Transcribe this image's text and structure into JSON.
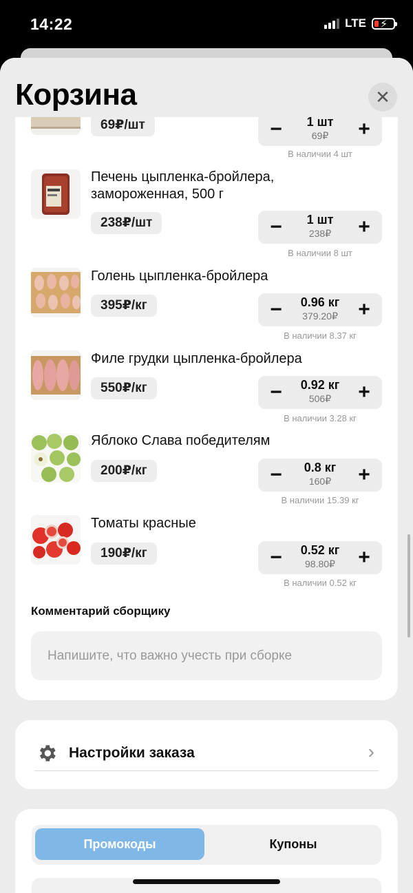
{
  "status": {
    "time": "14:22",
    "network": "LTE"
  },
  "header": {
    "title": "Корзина",
    "close_icon": "close-icon"
  },
  "cart": {
    "items": [
      {
        "name": "",
        "price": "69₽/шт",
        "qty": "1 шт",
        "sum": "69₽",
        "stock": "В наличии  4 шт",
        "thumb": "flatbread-product"
      },
      {
        "name": "Печень цыпленка-бройлера, замороженная, 500 г",
        "price": "238₽/шт",
        "qty": "1 шт",
        "sum": "238₽",
        "stock": "В наличии  8 шт",
        "thumb": "chicken-liver-pack"
      },
      {
        "name": "Голень цыпленка-бройлера",
        "price": "395₽/кг",
        "qty": "0.96 кг",
        "sum": "379.20₽",
        "stock": "В наличии  8.37 кг",
        "thumb": "chicken-drumsticks"
      },
      {
        "name": "Филе грудки цыпленка-бройлера",
        "price": "550₽/кг",
        "qty": "0.92 кг",
        "sum": "506₽",
        "stock": "В наличии  3.28 кг",
        "thumb": "chicken-breast-fillet"
      },
      {
        "name": "Яблоко Слава победителям",
        "price": "200₽/кг",
        "qty": "0.8 кг",
        "sum": "160₽",
        "stock": "В наличии  15.39 кг",
        "thumb": "green-apples"
      },
      {
        "name": "Томаты красные",
        "price": "190₽/кг",
        "qty": "0.52 кг",
        "sum": "98.80₽",
        "stock": "В наличии  0.52 кг",
        "thumb": "red-tomatoes"
      }
    ],
    "comment_label": "Комментарий сборщику",
    "comment_placeholder": "Напишите, что важно учесть при сборке"
  },
  "settings": {
    "label": "Настройки заказа",
    "icon": "gear-icon"
  },
  "promo": {
    "tabs": [
      "Промокоды",
      "Купоны"
    ],
    "active_tab": "Промокоды"
  },
  "colors": {
    "accent": "#7fb7e6",
    "background": "#ececec",
    "card": "#ffffff",
    "battery_low": "#ff3b30"
  }
}
